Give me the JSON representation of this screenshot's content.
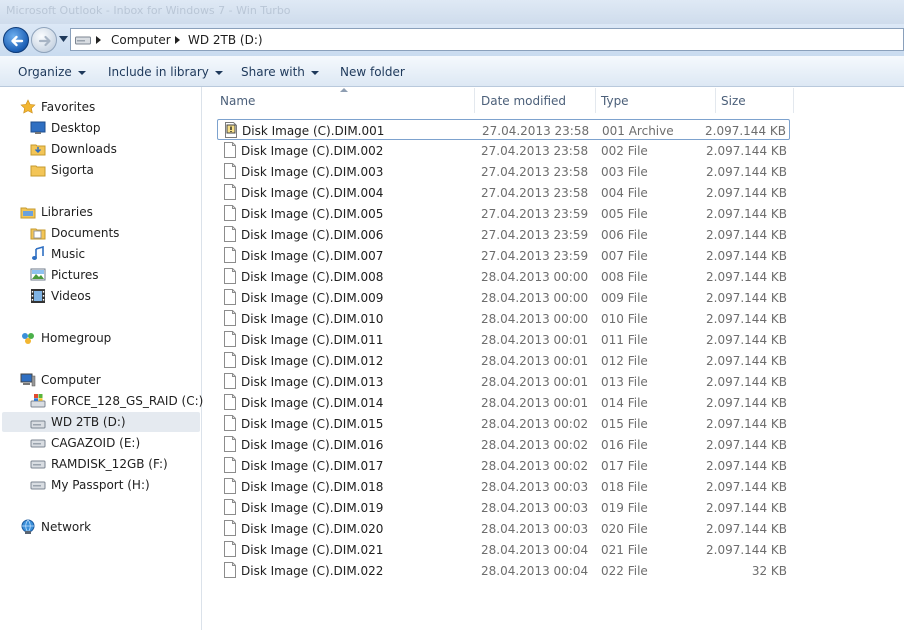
{
  "window": {
    "title": "Microsoft Outlook - Inbox for Windows 7 - Win Turbo"
  },
  "address": {
    "crumbs": [
      "Computer",
      "WD 2TB (D:)"
    ]
  },
  "toolbar": {
    "organize": "Organize",
    "include_library": "Include in library",
    "share_with": "Share with",
    "new_folder": "New folder"
  },
  "nav": {
    "favorites": "Favorites",
    "desktop": "Desktop",
    "downloads": "Downloads",
    "sigorta": "Sigorta",
    "libraries": "Libraries",
    "documents": "Documents",
    "music": "Music",
    "pictures": "Pictures",
    "videos": "Videos",
    "homegroup": "Homegroup",
    "computer": "Computer",
    "drive_c": "FORCE_128_GS_RAID (C:)",
    "drive_d": "WD 2TB (D:)",
    "drive_e": "CAGAZOID (E:)",
    "drive_f": "RAMDISK_12GB (F:)",
    "drive_h": "My Passport (H:)",
    "network": "Network"
  },
  "columns": {
    "name": "Name",
    "date": "Date modified",
    "type": "Type",
    "size": "Size"
  },
  "files": [
    {
      "name": "Disk Image (C).DIM.001",
      "date": "27.04.2013 23:58",
      "type": "001 Archive",
      "size": "2.097.144 KB"
    },
    {
      "name": "Disk Image (C).DIM.002",
      "date": "27.04.2013 23:58",
      "type": "002 File",
      "size": "2.097.144 KB"
    },
    {
      "name": "Disk Image (C).DIM.003",
      "date": "27.04.2013 23:58",
      "type": "003 File",
      "size": "2.097.144 KB"
    },
    {
      "name": "Disk Image (C).DIM.004",
      "date": "27.04.2013 23:58",
      "type": "004 File",
      "size": "2.097.144 KB"
    },
    {
      "name": "Disk Image (C).DIM.005",
      "date": "27.04.2013 23:59",
      "type": "005 File",
      "size": "2.097.144 KB"
    },
    {
      "name": "Disk Image (C).DIM.006",
      "date": "27.04.2013 23:59",
      "type": "006 File",
      "size": "2.097.144 KB"
    },
    {
      "name": "Disk Image (C).DIM.007",
      "date": "27.04.2013 23:59",
      "type": "007 File",
      "size": "2.097.144 KB"
    },
    {
      "name": "Disk Image (C).DIM.008",
      "date": "28.04.2013 00:00",
      "type": "008 File",
      "size": "2.097.144 KB"
    },
    {
      "name": "Disk Image (C).DIM.009",
      "date": "28.04.2013 00:00",
      "type": "009 File",
      "size": "2.097.144 KB"
    },
    {
      "name": "Disk Image (C).DIM.010",
      "date": "28.04.2013 00:00",
      "type": "010 File",
      "size": "2.097.144 KB"
    },
    {
      "name": "Disk Image (C).DIM.011",
      "date": "28.04.2013 00:01",
      "type": "011 File",
      "size": "2.097.144 KB"
    },
    {
      "name": "Disk Image (C).DIM.012",
      "date": "28.04.2013 00:01",
      "type": "012 File",
      "size": "2.097.144 KB"
    },
    {
      "name": "Disk Image (C).DIM.013",
      "date": "28.04.2013 00:01",
      "type": "013 File",
      "size": "2.097.144 KB"
    },
    {
      "name": "Disk Image (C).DIM.014",
      "date": "28.04.2013 00:01",
      "type": "014 File",
      "size": "2.097.144 KB"
    },
    {
      "name": "Disk Image (C).DIM.015",
      "date": "28.04.2013 00:02",
      "type": "015 File",
      "size": "2.097.144 KB"
    },
    {
      "name": "Disk Image (C).DIM.016",
      "date": "28.04.2013 00:02",
      "type": "016 File",
      "size": "2.097.144 KB"
    },
    {
      "name": "Disk Image (C).DIM.017",
      "date": "28.04.2013 00:02",
      "type": "017 File",
      "size": "2.097.144 KB"
    },
    {
      "name": "Disk Image (C).DIM.018",
      "date": "28.04.2013 00:03",
      "type": "018 File",
      "size": "2.097.144 KB"
    },
    {
      "name": "Disk Image (C).DIM.019",
      "date": "28.04.2013 00:03",
      "type": "019 File",
      "size": "2.097.144 KB"
    },
    {
      "name": "Disk Image (C).DIM.020",
      "date": "28.04.2013 00:03",
      "type": "020 File",
      "size": "2.097.144 KB"
    },
    {
      "name": "Disk Image (C).DIM.021",
      "date": "28.04.2013 00:04",
      "type": "021 File",
      "size": "2.097.144 KB"
    },
    {
      "name": "Disk Image (C).DIM.022",
      "date": "28.04.2013 00:04",
      "type": "022 File",
      "size": "32 KB"
    }
  ]
}
